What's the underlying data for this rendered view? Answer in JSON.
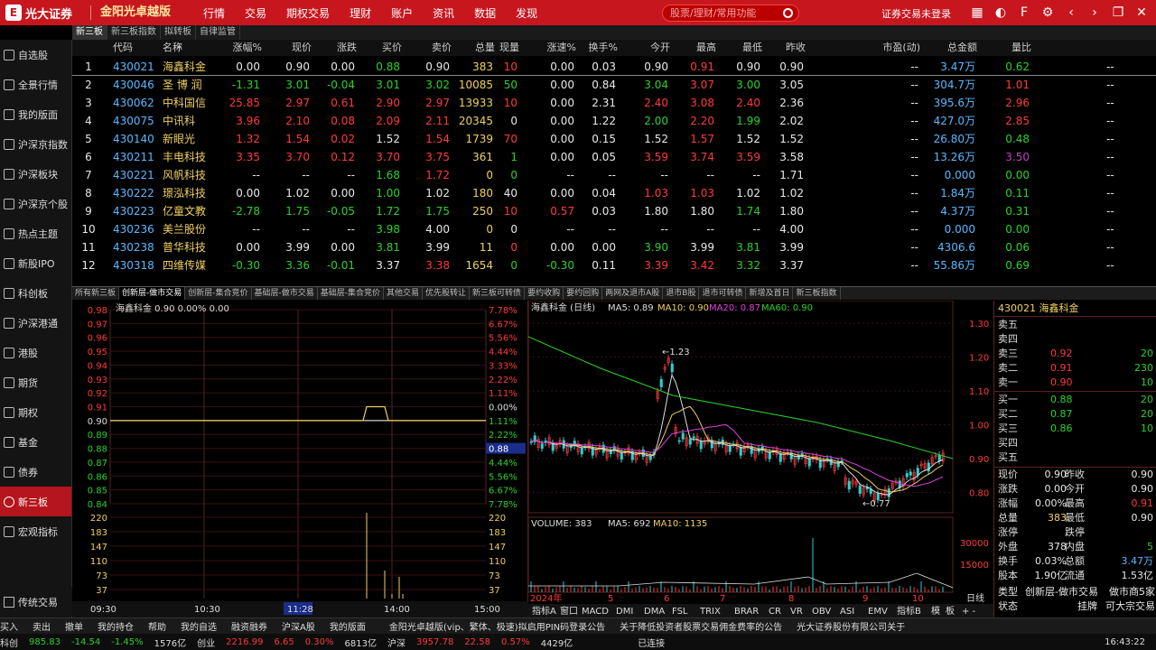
{
  "top": {
    "logo": "光大证券",
    "product": "金阳光卓越版",
    "menu": [
      "行情",
      "交易",
      "期权交易",
      "理财",
      "账户",
      "资讯",
      "数据",
      "发现"
    ],
    "search_placeholder": "股票/理财/常用功能",
    "login": "证券交易未登录"
  },
  "sidebar": [
    "自选股",
    "全景行情",
    "我的版面",
    "沪深京指数",
    "沪深板块",
    "沪深京个股",
    "热点主题",
    "新股IPO",
    "科创板",
    "沪深港通",
    "港股",
    "期货",
    "期权",
    "基金",
    "债券",
    "新三板",
    "宏观指标"
  ],
  "sidebar_active": "新三板",
  "sidebar_bottom": "传统交易",
  "subtabs": [
    "新三板",
    "新三板指数",
    "拟转板",
    "自律监管"
  ],
  "columns": [
    "代码",
    "名称",
    "•",
    "涨幅%",
    "现价",
    "涨跌",
    "买价",
    "卖价",
    "总量",
    "现量",
    "涨速%",
    "换手%",
    "今开",
    "最高",
    "最低",
    "昨收",
    "市盈(动)",
    "总金额",
    "量比"
  ],
  "rows": [
    [
      "1",
      "430021",
      "海鑫科金",
      "0.00",
      "0.90",
      "0.00",
      "0.88",
      "0.90",
      "383",
      "10",
      "0.00",
      "0.03",
      "0.90",
      "0.91",
      "0.90",
      "0.90",
      "--",
      "3.47万",
      "0.62"
    ],
    [
      "2",
      "430046",
      "圣 博 润",
      "-1.31",
      "3.01",
      "-0.04",
      "3.01",
      "3.02",
      "10085",
      "50",
      "0.00",
      "0.84",
      "3.04",
      "3.07",
      "3.00",
      "3.05",
      "--",
      "304.7万",
      "1.01"
    ],
    [
      "3",
      "430062",
      "中科国信",
      "25.85",
      "2.97",
      "0.61",
      "2.90",
      "2.97",
      "13933",
      "10",
      "0.00",
      "2.31",
      "2.40",
      "3.08",
      "2.40",
      "2.36",
      "--",
      "395.6万",
      "2.96"
    ],
    [
      "4",
      "430075",
      "中讯科",
      "3.96",
      "2.10",
      "0.08",
      "2.09",
      "2.11",
      "20345",
      "0",
      "0.00",
      "1.22",
      "2.00",
      "2.20",
      "1.99",
      "2.02",
      "--",
      "427.0万",
      "2.85"
    ],
    [
      "5",
      "430140",
      "新眼光",
      "1.32",
      "1.54",
      "0.02",
      "1.52",
      "1.54",
      "1739",
      "70",
      "0.00",
      "0.15",
      "1.52",
      "1.57",
      "1.52",
      "1.52",
      "--",
      "26.80万",
      "0.48"
    ],
    [
      "6",
      "430211",
      "丰电科技",
      "3.35",
      "3.70",
      "0.12",
      "3.70",
      "3.75",
      "361",
      "1",
      "0.00",
      "0.05",
      "3.59",
      "3.74",
      "3.59",
      "3.58",
      "--",
      "13.26万",
      "3.50"
    ],
    [
      "7",
      "430221",
      "风帆科技",
      "--",
      "--",
      "--",
      "1.68",
      "1.72",
      "0",
      "0",
      "--",
      "--",
      "--",
      "--",
      "--",
      "1.71",
      "--",
      "0.000",
      "0.00"
    ],
    [
      "8",
      "430222",
      "璟泓科技",
      "0.00",
      "1.02",
      "0.00",
      "1.00",
      "1.02",
      "180",
      "40",
      "0.00",
      "0.04",
      "1.03",
      "1.03",
      "1.02",
      "1.02",
      "--",
      "1.84万",
      "0.11"
    ],
    [
      "9",
      "430223",
      "亿童文教",
      "-2.78",
      "1.75",
      "-0.05",
      "1.72",
      "1.75",
      "250",
      "10",
      "0.57",
      "0.03",
      "1.80",
      "1.80",
      "1.74",
      "1.80",
      "--",
      "4.37万",
      "0.31"
    ],
    [
      "10",
      "430236",
      "美兰股份",
      "--",
      "--",
      "--",
      "3.98",
      "4.00",
      "0",
      "0",
      "--",
      "--",
      "--",
      "--",
      "--",
      "4.00",
      "--",
      "0.000",
      "0.00"
    ],
    [
      "11",
      "430238",
      "普华科技",
      "0.00",
      "3.99",
      "0.00",
      "3.81",
      "3.99",
      "11",
      "0",
      "0.00",
      "0.00",
      "3.90",
      "3.99",
      "3.81",
      "3.99",
      "--",
      "4306.6",
      "0.06"
    ],
    [
      "12",
      "430318",
      "四维传媒",
      "-0.30",
      "3.36",
      "-0.01",
      "3.37",
      "3.38",
      "1654",
      "0",
      "-0.30",
      "0.11",
      "3.39",
      "3.42",
      "3.32",
      "3.37",
      "--",
      "55.86万",
      "0.69"
    ]
  ],
  "row_colors": [
    [
      "w",
      "c",
      "y",
      "w",
      "w",
      "w",
      "g",
      "w",
      "y",
      "r",
      "w",
      "w",
      "w",
      "r",
      "w",
      "w",
      "w",
      "c",
      "g"
    ],
    [
      "w",
      "c",
      "y",
      "g",
      "g",
      "g",
      "g",
      "g",
      "y",
      "g",
      "w",
      "w",
      "g",
      "r",
      "g",
      "w",
      "w",
      "c",
      "r"
    ],
    [
      "w",
      "c",
      "y",
      "r",
      "r",
      "r",
      "r",
      "r",
      "y",
      "r",
      "w",
      "w",
      "r",
      "r",
      "r",
      "w",
      "w",
      "c",
      "r"
    ],
    [
      "w",
      "c",
      "y",
      "r",
      "r",
      "r",
      "r",
      "r",
      "y",
      "w",
      "w",
      "w",
      "g",
      "r",
      "g",
      "w",
      "w",
      "c",
      "r"
    ],
    [
      "w",
      "c",
      "y",
      "r",
      "r",
      "r",
      "w",
      "r",
      "y",
      "r",
      "w",
      "w",
      "w",
      "r",
      "w",
      "w",
      "w",
      "c",
      "g"
    ],
    [
      "w",
      "c",
      "y",
      "r",
      "r",
      "r",
      "r",
      "r",
      "y",
      "g",
      "w",
      "w",
      "r",
      "r",
      "r",
      "w",
      "w",
      "c",
      "m"
    ],
    [
      "w",
      "c",
      "y",
      "w",
      "w",
      "w",
      "g",
      "r",
      "y",
      "g",
      "w",
      "w",
      "w",
      "w",
      "w",
      "w",
      "w",
      "c",
      "g"
    ],
    [
      "w",
      "c",
      "y",
      "w",
      "w",
      "w",
      "g",
      "w",
      "y",
      "w",
      "w",
      "w",
      "r",
      "r",
      "w",
      "w",
      "w",
      "c",
      "g"
    ],
    [
      "w",
      "c",
      "y",
      "g",
      "g",
      "g",
      "g",
      "g",
      "y",
      "r",
      "r",
      "w",
      "w",
      "w",
      "g",
      "w",
      "w",
      "c",
      "g"
    ],
    [
      "w",
      "c",
      "y",
      "w",
      "w",
      "w",
      "g",
      "w",
      "y",
      "w",
      "w",
      "w",
      "w",
      "w",
      "w",
      "w",
      "w",
      "c",
      "g"
    ],
    [
      "w",
      "c",
      "y",
      "w",
      "w",
      "w",
      "g",
      "w",
      "y",
      "r",
      "w",
      "w",
      "g",
      "w",
      "g",
      "w",
      "w",
      "c",
      "g"
    ],
    [
      "w",
      "c",
      "y",
      "g",
      "g",
      "g",
      "w",
      "r",
      "y",
      "g",
      "g",
      "w",
      "r",
      "r",
      "g",
      "w",
      "w",
      "c",
      "g"
    ]
  ],
  "market_tabs": [
    "所有新三板",
    "创新层-做市交易",
    "创新层-集合竞价",
    "基础层-做市交易",
    "基础层-集合竞价",
    "其他交易",
    "优先股转让",
    "新三板可转债",
    "要约收购",
    "要约回购",
    "两网及退市A股",
    "退市B股",
    "退市可转债",
    "新增及首日",
    "新三板指数"
  ],
  "intraday": {
    "title": "海鑫科金",
    "price": "0.90",
    "pct": "0.00%",
    "extra": "0.00",
    "left_ticks": [
      "0.98",
      "0.97",
      "0.96",
      "0.95",
      "0.94",
      "0.93",
      "0.92",
      "0.91",
      "0.90",
      "0.89",
      "0.88",
      "0.87",
      "0.86",
      "0.85",
      "0.84"
    ],
    "right_ticks": [
      "7.78%",
      "6.67%",
      "5.56%",
      "4.44%",
      "3.33%",
      "2.22%",
      "1.11%",
      "0.00%",
      "1.11%",
      "2.22%",
      "3.33%",
      "4.44%",
      "5.56%",
      "6.67%",
      "7.78%"
    ],
    "vol_ticks": [
      "220",
      "183",
      "147",
      "110",
      "73",
      "37"
    ],
    "times": [
      "09:30",
      "10:30",
      "11:28",
      "14:00",
      "15:00"
    ],
    "cursor_price": "0.88"
  },
  "kline": {
    "title": "海鑫科金 (日线)",
    "ma5": "MA5: 0.89",
    "ma10": "MA10: 0.90",
    "ma20": "MA20: 0.87",
    "ma60": "MA60: 0.90",
    "high_label": "1.23",
    "low_label": "0.77",
    "yticks": [
      "1.30",
      "1.20",
      "1.10",
      "1.00",
      "0.90",
      "0.80"
    ],
    "vol_title": "VOLUME: 383",
    "vol_ma5": "MA5: 692",
    "vol_ma10": "MA10: 1135",
    "vol_ticks": [
      "30000",
      "15000"
    ],
    "dates": [
      "2024年",
      "5",
      "6",
      "7",
      "8",
      "9",
      "10"
    ],
    "period": "日线",
    "indicators": [
      "指标A",
      "窗口",
      "MACD",
      "DMI",
      "DMA",
      "FSL",
      "TRIX",
      "BRAR",
      "CR",
      "VR",
      "OBV",
      "ASI",
      "EMV"
    ],
    "indB": "指标B",
    "mod": "模",
    "board": "板"
  },
  "quote": {
    "title": "430021 海鑫科金",
    "sells": [
      [
        "卖五",
        "",
        ""
      ],
      [
        "卖四",
        "",
        ""
      ],
      [
        "卖三",
        "0.92",
        "20"
      ],
      [
        "卖二",
        "0.91",
        "230"
      ],
      [
        "卖一",
        "0.90",
        "10"
      ]
    ],
    "buys": [
      [
        "买一",
        "0.88",
        "20"
      ],
      [
        "买二",
        "0.87",
        "20"
      ],
      [
        "买三",
        "0.86",
        "10"
      ],
      [
        "买四",
        "",
        ""
      ],
      [
        "买五",
        "",
        ""
      ]
    ],
    "stats": [
      [
        "现价",
        "0.90",
        "昨收",
        "0.90"
      ],
      [
        "涨跌",
        "0.00",
        "今开",
        "0.90"
      ],
      [
        "涨幅",
        "0.00%",
        "最高",
        "0.91"
      ],
      [
        "总量",
        "383",
        "最低",
        "0.90"
      ],
      [
        "涨停",
        "",
        "跌停",
        ""
      ],
      [
        "外盘",
        "378",
        "内盘",
        "5"
      ],
      [
        "换手",
        "0.03%",
        "总额",
        "3.47万"
      ],
      [
        "股本",
        "1.90亿",
        "流通",
        "1.53亿"
      ]
    ],
    "type_label": "类型",
    "type_val": "创新层-做市交易",
    "makers": "做市商5家",
    "state_label": "状态",
    "state_val": "挂牌",
    "state_val2": "可大宗交易"
  },
  "bottombar": [
    "买入",
    "卖出",
    "撤单",
    "我的持仓",
    "帮助",
    "我的自选",
    "融资融券",
    "沪深A股",
    "我的版面",
    "金阳光卓越版(vip、繁体、极速)拟启用PIN码登录公告",
    "关于降低投资者股票交易佣金费率的公告",
    "光大证券股份有限公司关于"
  ],
  "status": {
    "kechuang": "科创",
    "kc_val": "985.83",
    "kc_chg": "-14.54",
    "kc_pct": "-1.45%",
    "kc_vol": "1576亿",
    "cy": "创业",
    "cy_val": "2216.99",
    "cy_chg": "6.65",
    "cy_pct": "0.30%",
    "cy_vol": "6813亿",
    "hs": "沪深",
    "hs_val": "3957.78",
    "hs_chg": "22.58",
    "hs_pct": "0.57%",
    "hs_vol": "4429亿",
    "conn": "已连接",
    "time": "16:43:22"
  }
}
